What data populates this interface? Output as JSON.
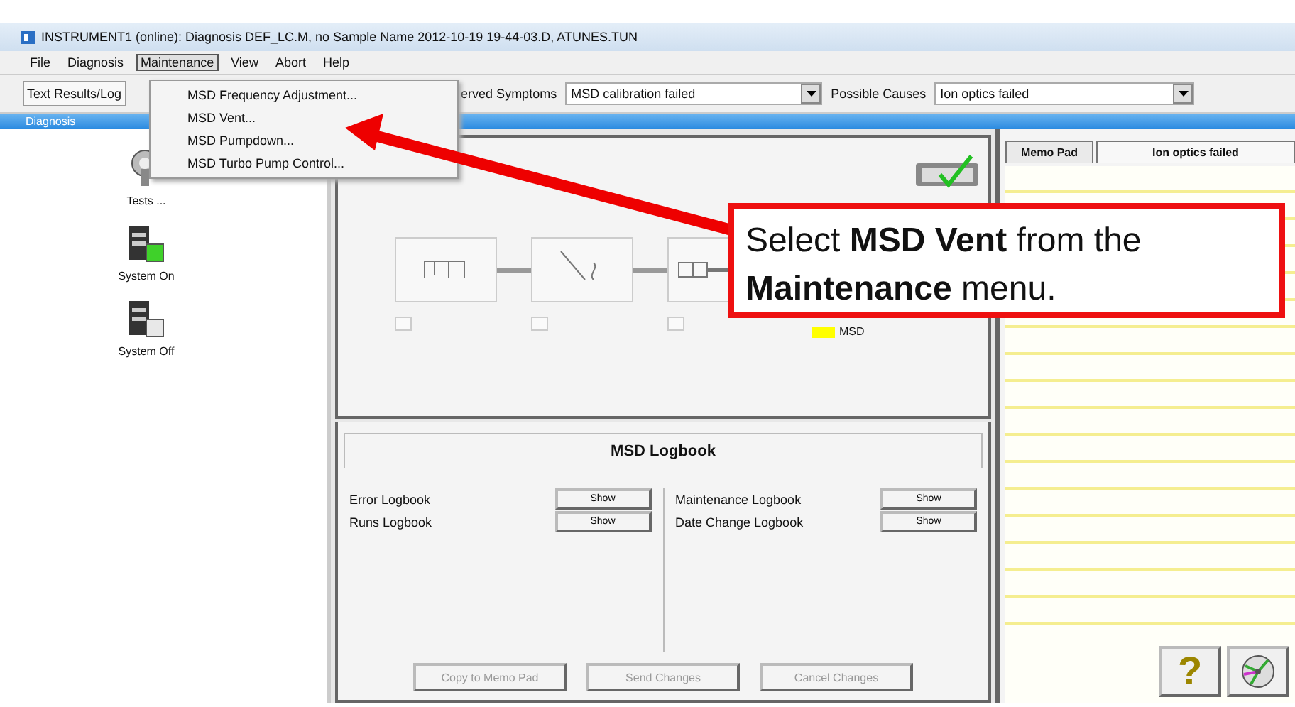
{
  "window": {
    "title": "INSTRUMENT1 (online): Diagnosis DEF_LC.M, no Sample Name 2012-10-19 19-44-03.D, ATUNES.TUN"
  },
  "menu_bar": [
    {
      "label": "File",
      "selected": false
    },
    {
      "label": "Diagnosis",
      "selected": false
    },
    {
      "label": "Maintenance",
      "selected": true
    },
    {
      "label": "View",
      "selected": false
    },
    {
      "label": "Abort",
      "selected": false
    },
    {
      "label": "Help",
      "selected": false
    }
  ],
  "open_menu": [
    {
      "label": "MSD Frequency Adjustment..."
    },
    {
      "label": "MSD Vent..."
    },
    {
      "label": "MSD Pumpdown..."
    },
    {
      "label": "MSD Turbo Pump Control..."
    }
  ],
  "toolbar": {
    "tab": "Text Results/Log",
    "symptoms_label": "erved Symptoms",
    "symptoms_value": "MSD calibration failed",
    "causes_label": "Possible Causes",
    "causes_value": "Ion optics failed"
  },
  "panel_title": "Diagnosis",
  "sidebar": {
    "items": [
      {
        "label": "Tests ...",
        "kind": "tests"
      },
      {
        "label": "System On",
        "kind": "on"
      },
      {
        "label": "System Off",
        "kind": "off"
      }
    ]
  },
  "schematic": {
    "modules": [
      {
        "checked": false
      },
      {
        "checked": false
      },
      {
        "checked": false
      }
    ],
    "legend": {
      "label": "MSD",
      "color": "#ffff00"
    }
  },
  "logbook": {
    "title": "MSD Logbook",
    "left": [
      {
        "label": "Error Logbook",
        "button": "Show"
      },
      {
        "label": "Runs Logbook",
        "button": "Show"
      }
    ],
    "right": [
      {
        "label": "Maintenance Logbook",
        "button": "Show"
      },
      {
        "label": "Date Change Logbook",
        "button": "Show"
      }
    ],
    "actions": [
      {
        "label": "Copy to Memo Pad",
        "disabled": true
      },
      {
        "label": "Send Changes",
        "disabled": true
      },
      {
        "label": "Cancel Changes",
        "disabled": true
      }
    ]
  },
  "memo": {
    "tabs": [
      {
        "label": "Memo Pad",
        "selected": false
      },
      {
        "label": "Ion optics failed",
        "selected": true
      }
    ],
    "buttons": [
      {
        "label": "?",
        "kind": "help"
      },
      {
        "kind": "disk"
      }
    ]
  },
  "callout": {
    "text": "Select **MSD Vent** from the **Maintenance** menu."
  }
}
